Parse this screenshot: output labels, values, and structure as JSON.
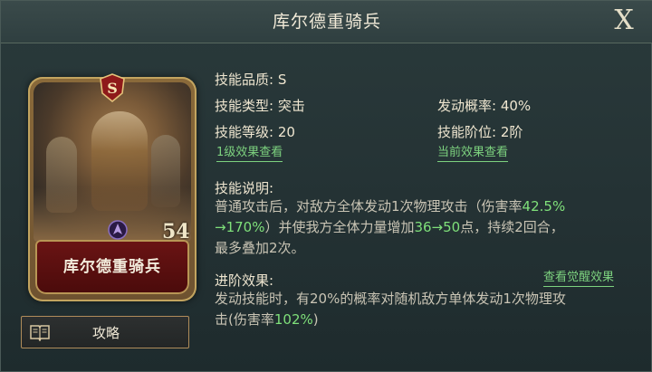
{
  "window": {
    "title": "库尔德重骑兵",
    "close_label": "X"
  },
  "card": {
    "rank_letter": "S",
    "level_label": "54",
    "name": "库尔德重骑兵",
    "name_color": "#f3ecdc",
    "plate_color": "#6b1414"
  },
  "guide_button": {
    "label": "攻略"
  },
  "skill": {
    "quality_label": "技能品质:",
    "quality_value": "S",
    "type_label": "技能类型:",
    "type_value": "突击",
    "trigger_label": "发动概率:",
    "trigger_value": "40%",
    "level_label": "技能等级:",
    "level_value": "20",
    "stage_label": "技能阶位:",
    "stage_value": "2阶",
    "link_level1": "1级效果查看",
    "link_current": "当前效果查看"
  },
  "description": {
    "title": "技能说明:",
    "line1_a": "普通攻击后，对敌方全体发动1次物理攻击（伤害率",
    "line1_hl": "42.5%",
    "line2_hl": "→170%",
    "line2_a": "）并使我方全体力量增加",
    "line2_hl2": "36→50",
    "line2_b": "点，持续2回合，",
    "line3": "最多叠加2次。"
  },
  "advance": {
    "title": "进阶效果:",
    "link": "查看觉醒效果",
    "line1": "发动技能时，有20%的概率对随机敌方单体发动1次物理攻",
    "line2_a": "击(伤害率",
    "line2_hl": "102%",
    "line2_b": ")"
  },
  "colors": {
    "highlight": "#7fe07a",
    "link": "#7dd27f",
    "border_gold": "#b08c5a"
  }
}
